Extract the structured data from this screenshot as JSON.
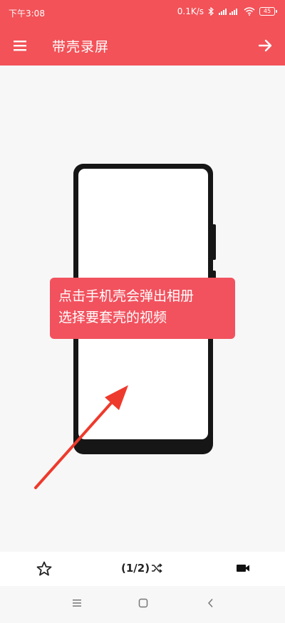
{
  "status_bar": {
    "time": "下午3:08",
    "net_speed": "0.1K/s",
    "battery": "45"
  },
  "app_bar": {
    "title": "带壳录屏",
    "menu_icon": "hamburger-menu-icon",
    "next_icon": "arrow-right-icon"
  },
  "main": {
    "hint_line1": "点击手机壳会弹出相册",
    "hint_line2": "选择要套壳的视频"
  },
  "toolbar": {
    "star_icon": "star-outline-icon",
    "counter": "(1/2)",
    "shuffle_icon": "shuffle-icon",
    "video_icon": "video-camera-icon"
  },
  "navbar": {
    "menu_icon": "nav-menu-icon",
    "home_icon": "nav-home-icon",
    "back_icon": "nav-back-icon"
  },
  "colors": {
    "accent": "#f25258",
    "hint_bg": "#f2525e",
    "arrow": "#ee3a2c"
  }
}
